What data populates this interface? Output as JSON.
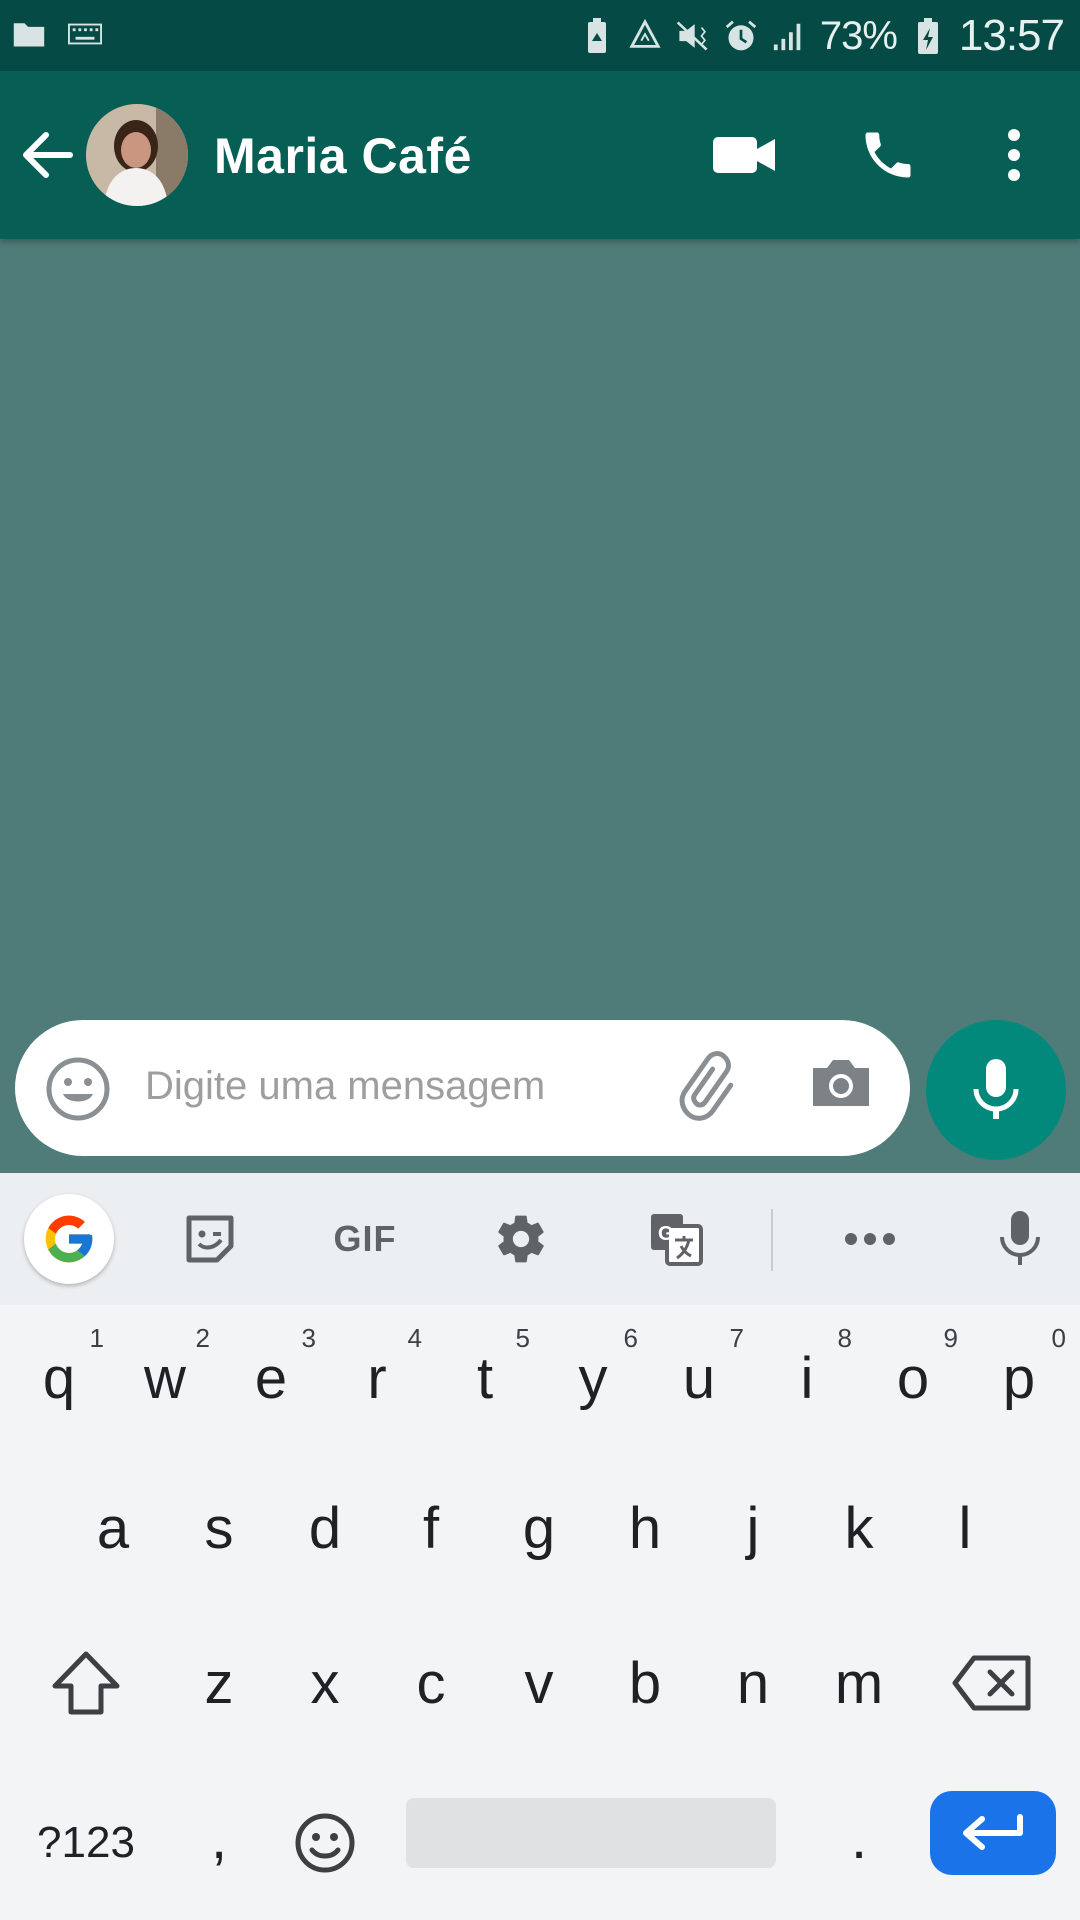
{
  "status_bar": {
    "battery_percent": "73%",
    "time": "13:57"
  },
  "header": {
    "contact_name": "Maria Café"
  },
  "composer": {
    "placeholder": "Digite uma mensagem"
  },
  "keyboard": {
    "toolbar": {
      "gif_label": "GIF"
    },
    "row1": [
      {
        "k": "q",
        "n": "1"
      },
      {
        "k": "w",
        "n": "2"
      },
      {
        "k": "e",
        "n": "3"
      },
      {
        "k": "r",
        "n": "4"
      },
      {
        "k": "t",
        "n": "5"
      },
      {
        "k": "y",
        "n": "6"
      },
      {
        "k": "u",
        "n": "7"
      },
      {
        "k": "i",
        "n": "8"
      },
      {
        "k": "o",
        "n": "9"
      },
      {
        "k": "p",
        "n": "0"
      }
    ],
    "row2": [
      "a",
      "s",
      "d",
      "f",
      "g",
      "h",
      "j",
      "k",
      "l"
    ],
    "row3": [
      "z",
      "x",
      "c",
      "v",
      "b",
      "n",
      "m"
    ],
    "row4": {
      "symbols": "?123",
      "comma": ",",
      "period": "."
    }
  },
  "colors": {
    "header": "#075e55",
    "status_bar": "#054a44",
    "chat_background": "#4f7c79",
    "accent_fab": "#03897b",
    "enter_key": "#1a73e8"
  }
}
